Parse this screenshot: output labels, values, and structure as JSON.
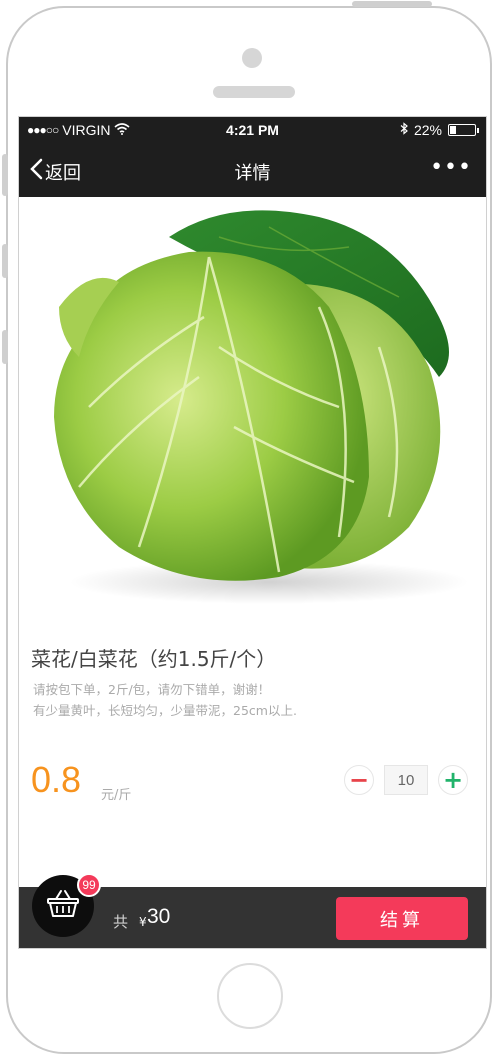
{
  "status_bar": {
    "signal": "●●●○○",
    "carrier": "VIRGIN",
    "wifi_icon": "wifi-icon",
    "time": "4:21 PM",
    "bluetooth_icon": "bluetooth-icon",
    "battery_percent": "22%"
  },
  "nav": {
    "back_label": "返回",
    "title": "详情",
    "more_label": "•••"
  },
  "product": {
    "title": "菜花/白菜花（约1.5斤/个）",
    "desc_line1": "请按包下单，2斤/包，请勿下错单，谢谢！",
    "desc_line2": "有少量黄叶，长短均匀，少量带泥，25cm以上.",
    "price": "0.8",
    "unit": "元/斤",
    "quantity": "10",
    "minus_label": "−",
    "plus_label": "+"
  },
  "cart": {
    "badge_count": "99",
    "total_label": "共",
    "currency": "¥",
    "total_value": "30",
    "checkout_label": "结算"
  },
  "colors": {
    "price": "#f7931e",
    "checkout": "#f43a5a",
    "plus": "#21b36b",
    "minus": "#e8434a",
    "bar": "#333333"
  }
}
